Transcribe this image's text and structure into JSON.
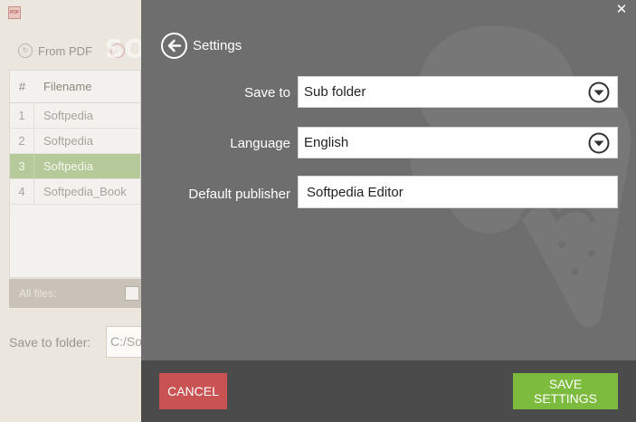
{
  "app": {
    "tabs": [
      {
        "label": "From PDF",
        "icon": "from-pdf-icon"
      },
      {
        "label": "",
        "icon": "to-pdf-icon"
      }
    ],
    "table": {
      "headers": [
        "#",
        "Filename"
      ],
      "rows": [
        {
          "num": "1",
          "name": "Softpedia"
        },
        {
          "num": "2",
          "name": "Softpedia"
        },
        {
          "num": "3",
          "name": "Softpedia",
          "selected": true
        },
        {
          "num": "4",
          "name": "Softpedia_Book"
        }
      ]
    },
    "all_files_label": "All files:",
    "save_to_folder_label": "Save to folder:",
    "save_to_folder_value": "C:/So"
  },
  "watermark_text": "SOFTPEDIA",
  "settings": {
    "title": "Settings",
    "fields": {
      "save_to": {
        "label": "Save to",
        "value": "Sub folder"
      },
      "language": {
        "label": "Language",
        "value": "English"
      },
      "publisher": {
        "label": "Default publisher",
        "value": "Softpedia Editor"
      }
    },
    "cancel_label": "CANCEL",
    "save_label": "SAVE SETTINGS"
  },
  "colors": {
    "overlay": "#6e6e6e",
    "footer": "#4b4b4b",
    "cancel": "#c95353",
    "save": "#7dbb3f",
    "selected_row": "#b6c99a"
  }
}
